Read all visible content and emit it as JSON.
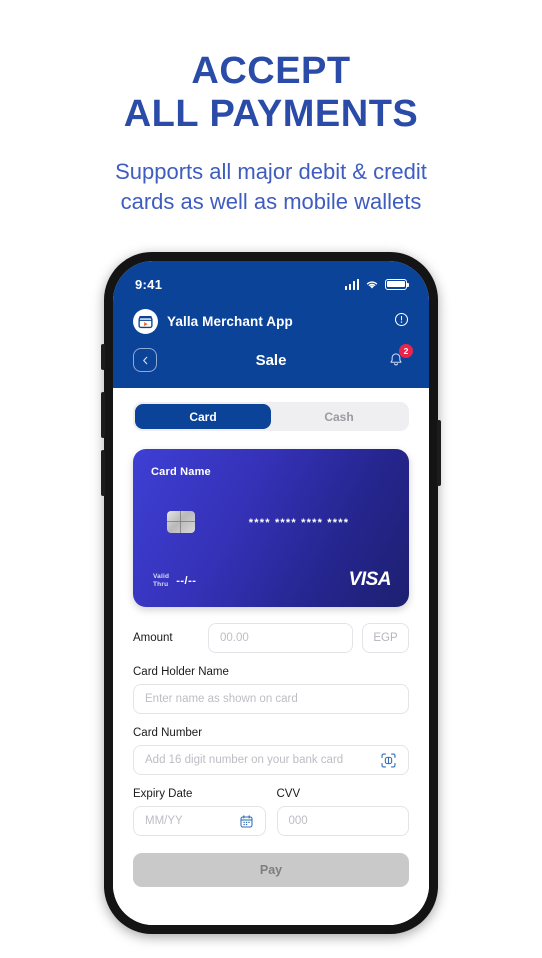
{
  "promo": {
    "headline_line1": "ACCEPT",
    "headline_line2": "ALL PAYMENTS",
    "subhead_line1": "Supports all major debit & credit",
    "subhead_line2": "cards as well as mobile wallets",
    "headline_color": "#2B4BA8",
    "subhead_color": "#3F5CC0"
  },
  "phone": {
    "status_bar": {
      "time": "9:41",
      "signal_icon": "signal-bars-icon",
      "wifi_icon": "wifi-icon",
      "battery_icon": "battery-full-icon"
    },
    "app_header": {
      "logo_icon": "store-play-logo-icon",
      "merchant_name": "Yalla Merchant App",
      "info_icon": "info-circle-icon",
      "back_icon": "chevron-left-icon",
      "screen_title": "Sale",
      "bell_icon": "bell-icon",
      "notification_count": "2",
      "header_color": "#0B4399",
      "badge_color": "#E8254B"
    },
    "segmented": {
      "options": [
        {
          "label": "Card",
          "active": true
        },
        {
          "label": "Cash",
          "active": false
        }
      ],
      "active_color": "#0B4399",
      "track_color": "#EFEFF1"
    },
    "credit_card": {
      "card_name": "Card Name",
      "card_number": "**** **** **** ****",
      "valid_label_line1": "Valid",
      "valid_label_line2": "Thru",
      "valid_value": "--/--",
      "brand": "VISA",
      "chip_icon": "emv-chip-icon",
      "gradient_from": "#3E3FD4",
      "gradient_to": "#1D2070"
    },
    "form": {
      "amount_label": "Amount",
      "amount_placeholder": "00.00",
      "currency": "EGP",
      "card_holder_label": "Card Holder Name",
      "card_holder_placeholder": "Enter name as shown on card",
      "card_number_label": "Card Number",
      "card_number_placeholder": "Add 16 digit number on your bank card",
      "scan_icon": "scan-card-icon",
      "expiry_label": "Expiry Date",
      "expiry_placeholder": "MM/YY",
      "calendar_icon": "calendar-icon",
      "cvv_label": "CVV",
      "cvv_placeholder": "000",
      "pay_label": "Pay",
      "pay_disabled_color": "#C9C9C9"
    }
  }
}
